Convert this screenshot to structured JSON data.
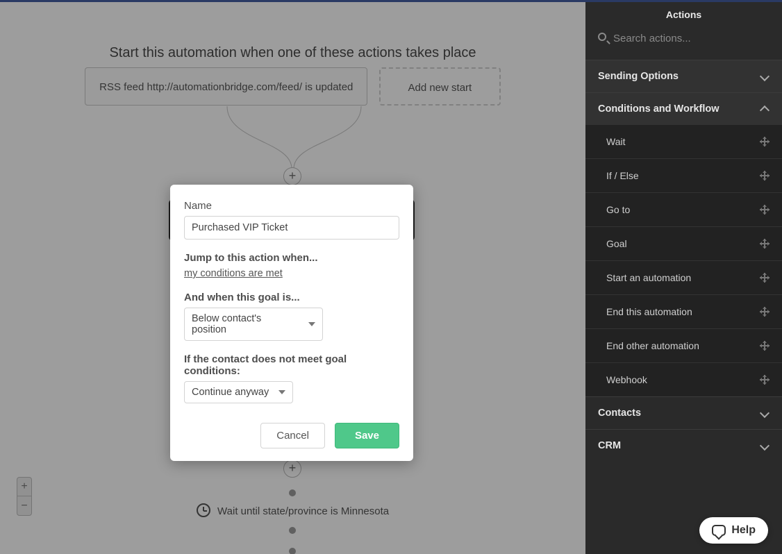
{
  "canvas": {
    "prompt": "Start this automation when one of these actions takes place",
    "start_card": "RSS feed http://automationbridge.com/feed/ is updated",
    "add_start": "Add new start",
    "wait_text": "Wait until state/province is Minnesota"
  },
  "modal": {
    "name_label": "Name",
    "name_value": "Purchased VIP Ticket",
    "jump_label": "Jump to this action when...",
    "jump_link": "my conditions are met",
    "goal_label": "And when this goal is...",
    "goal_select": "Below contact's position",
    "fail_label": "If the contact does not meet goal conditions:",
    "fail_select": "Continue anyway",
    "cancel": "Cancel",
    "save": "Save"
  },
  "sidebar": {
    "title": "Actions",
    "search_placeholder": "Search actions...",
    "sections": {
      "sending": "Sending Options",
      "conditions": "Conditions and Workflow",
      "contacts": "Contacts",
      "crm": "CRM"
    },
    "items": [
      "Wait",
      "If / Else",
      "Go to",
      "Goal",
      "Start an automation",
      "End this automation",
      "End other automation",
      "Webhook"
    ]
  },
  "help": "Help"
}
